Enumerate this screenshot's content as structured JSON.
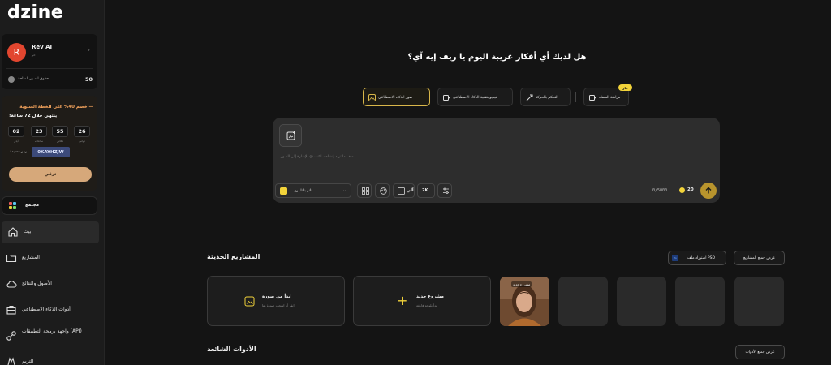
{
  "app": {
    "logo": "dzine"
  },
  "user": {
    "initial": "R",
    "name": "Rev AI",
    "plan": "حر",
    "credits_label": "حقوق الصور المتاحة",
    "credits_value": "50"
  },
  "promo": {
    "title": "— خصم 40% على الخطة السنوية",
    "ends": "ينتهي خلال 72 ساعة!",
    "timer": [
      {
        "value": "02",
        "label": "أيام"
      },
      {
        "value": "23",
        "label": "ساعات"
      },
      {
        "value": "55",
        "label": "دقائق"
      },
      {
        "value": "26",
        "label": "ثواني"
      }
    ],
    "code_label": "رمز قسيمة",
    "code": "0KAYHZJW",
    "button": "ترقي"
  },
  "community": {
    "label": "مجتمع"
  },
  "nav": [
    {
      "label": "بيت",
      "icon": "home-icon",
      "active": true
    },
    {
      "label": "المشاريع",
      "icon": "folder-icon"
    },
    {
      "label": "الأصول والنتائج",
      "icon": "cloud-icon"
    },
    {
      "label": "أدوات الذكاء الاصطناعي",
      "icon": "toolbox-icon"
    },
    {
      "label": "واجهة برمجة التطبيقات (API)",
      "icon": "api-icon"
    },
    {
      "label": "التريم",
      "icon": "pricing-icon"
    }
  ],
  "main": {
    "headline": "هل لديك أي أفكار غريبة اليوم يا ريف إيه آي؟",
    "tabs": [
      {
        "label": "صور الذكاء الاصطناعي",
        "icon": "image-icon",
        "selected": true
      },
      {
        "label": "فيديو بتقنية الذكاء الاصطناعي",
        "icon": "video-icon"
      },
      {
        "label": "التحكم بالحركة",
        "icon": "motion-icon"
      },
      {
        "label": "مزامنة الشفاه",
        "icon": "lipsync-icon",
        "badge": "حار"
      }
    ],
    "prompt": {
      "placeholder": "صف ما تريد إنشاءه، اكتب @ للإشارة إلى الصور",
      "style_label": "نانو بنانا برو",
      "resolution": "2K",
      "aspect_label": "آلي",
      "char_count": "0/5000",
      "cost": "20"
    },
    "recent": {
      "title": "المشاريع الحديثة",
      "view_all": "عرض جميع المشاريع",
      "import_psd": "استيراد ملف PSD",
      "psd_badge": "Ps",
      "new_project_title": "مشروع جديد",
      "new_project_sub": "ابدأ بلوحة فارغة",
      "from_image_title": "ابدأ من صورة",
      "from_image_sub": "انقر أو اسحب صورة هنا",
      "thumb_label": "مشروع جديد"
    },
    "tools": {
      "title": "الأدوات الشائعة",
      "view_all": "عرض جميع الأدوات"
    }
  },
  "colors": {
    "accent": "#d9b74a",
    "background": "#141414",
    "sidebar": "#1c1c1c",
    "panel": "#2d2d2d",
    "avatar": "#e2462f",
    "promo_text": "#f2a25c",
    "button_gold": "#d6a87a"
  }
}
